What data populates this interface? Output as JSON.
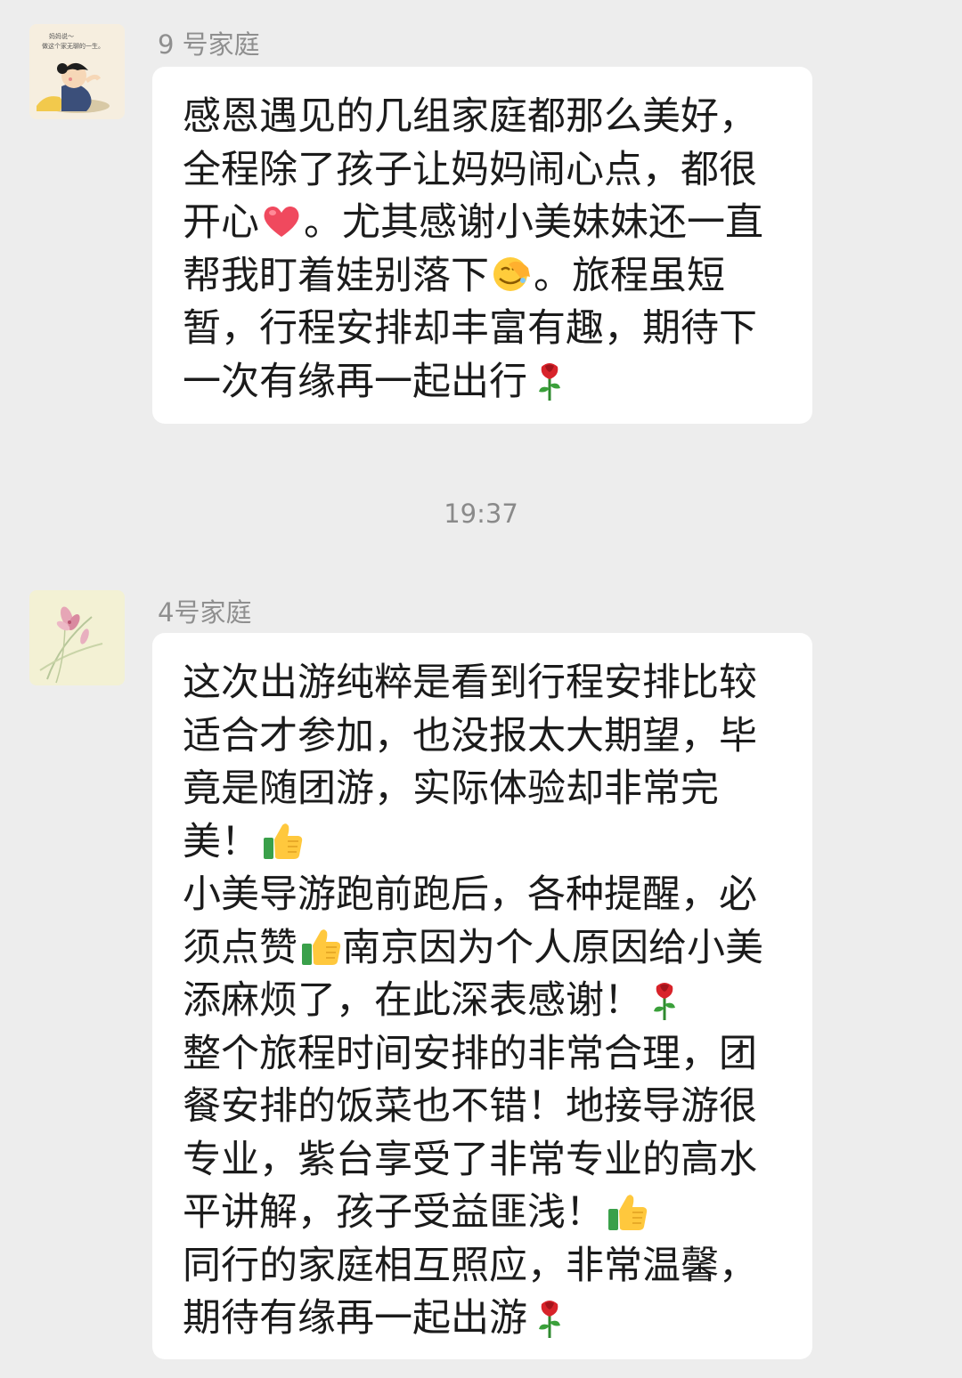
{
  "messages": [
    {
      "sender": "9 号家庭",
      "lines": [
        [
          {
            "t": "感恩遇见的几组家庭都那么美好，"
          }
        ],
        [
          {
            "t": "全程除了孩子让妈妈闹心点，都很"
          }
        ],
        [
          {
            "t": "开心"
          },
          {
            "icon": "heart-icon"
          },
          {
            "t": "。尤其感谢小美妹妹还一直"
          }
        ],
        [
          {
            "t": "帮我盯着娃别落下"
          },
          {
            "icon": "facepalm-icon"
          },
          {
            "t": "。旅程虽短"
          }
        ],
        [
          {
            "t": "暂，行程安排却丰富有趣，期待下"
          }
        ],
        [
          {
            "t": "一次有缘再一起出行"
          },
          {
            "icon": "rose-icon"
          }
        ]
      ]
    },
    {
      "sender": "4号家庭",
      "lines": [
        [
          {
            "t": "这次出游纯粹是看到行程安排比较"
          }
        ],
        [
          {
            "t": "适合才参加，也没报太大期望，毕"
          }
        ],
        [
          {
            "t": "竟是随团游，实际体验却非常完"
          }
        ],
        [
          {
            "t": "美！"
          },
          {
            "icon": "thumbs-up-icon"
          }
        ],
        [
          {
            "t": "小美导游跑前跑后，各种提醒，必"
          }
        ],
        [
          {
            "t": "须点赞"
          },
          {
            "icon": "thumbs-up-icon"
          },
          {
            "t": "南京因为个人原因给小美"
          }
        ],
        [
          {
            "t": "添麻烦了，在此深表感谢！"
          },
          {
            "icon": "rose-icon"
          }
        ],
        [
          {
            "t": "整个旅程时间安排的非常合理，团"
          }
        ],
        [
          {
            "t": "餐安排的饭菜也不错！地接导游很"
          }
        ],
        [
          {
            "t": "专业，紫台享受了非常专业的高水"
          }
        ],
        [
          {
            "t": "平讲解，孩子受益匪浅！"
          },
          {
            "icon": "thumbs-up-icon"
          }
        ],
        [
          {
            "t": "同行的家庭相互照应，非常温馨，"
          }
        ],
        [
          {
            "t": "期待有缘再一起出游"
          },
          {
            "icon": "rose-icon"
          }
        ]
      ]
    }
  ],
  "timestamp": "19:37",
  "avatar1_caption": [
    "妈妈说～",
    "做这个家无聊的一生。"
  ],
  "colors": {
    "background": "#ededed",
    "bubble": "#ffffff",
    "text": "#1b1b1b",
    "meta": "#8f8f8f"
  }
}
